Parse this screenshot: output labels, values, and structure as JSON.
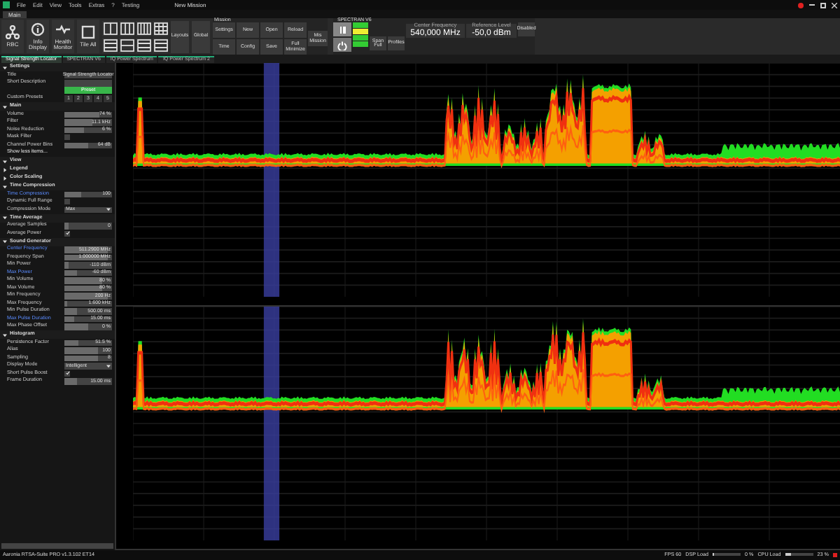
{
  "window": {
    "title": "New Mission"
  },
  "menu": [
    "File",
    "Edit",
    "View",
    "Tools",
    "Extras",
    "?",
    "Testing"
  ],
  "ribbon_tab": {
    "label": "Main",
    "selected": true
  },
  "ribbon_tools": [
    {
      "label": "RBC",
      "kind": "nodes"
    },
    {
      "label": "Info Display",
      "kind": "info"
    },
    {
      "label": "Health Monitor",
      "kind": "pulse"
    },
    {
      "label": "Tile All",
      "kind": "square"
    }
  ],
  "layouts_label": "Layouts",
  "global_label": "Global",
  "mission": {
    "title": "Mission",
    "buttons": [
      "Settings",
      "New",
      "Open",
      "Reload",
      "Time",
      "Config",
      "Save",
      "Full Minimize"
    ],
    "big_button": "Mis Mission"
  },
  "spectran": {
    "title": "SPECTRAN V6",
    "span": "Span Full",
    "profiles": "Profiles",
    "center_label": "Center Frequency",
    "center": "540,000 MHz",
    "ref_label": "Reference Level",
    "ref": "-50,0 dBm",
    "mode": "Disabled"
  },
  "doc_tabs": [
    {
      "label": "Signal Strength Locator",
      "selected": true
    },
    {
      "label": "SPECTRAN V6",
      "selected": false
    },
    {
      "label": "IQ Power Spectrum",
      "selected": false
    },
    {
      "label": "IQ Power Spectrum 2",
      "selected": false
    }
  ],
  "properties": [
    {
      "kind": "header",
      "label": "Settings",
      "expanded": true
    },
    {
      "kind": "text",
      "label": "Title",
      "value": "Signal Strength Locator"
    },
    {
      "kind": "text",
      "label": "Short Description"
    },
    {
      "kind": "button",
      "label": "Preset"
    },
    {
      "kind": "presets",
      "label": "Custom Presets",
      "values": [
        "1",
        "2",
        "3",
        "4",
        "5"
      ]
    },
    {
      "kind": "header",
      "label": "Main",
      "expanded": true
    },
    {
      "kind": "slider",
      "label": "Volume",
      "value": "74 %",
      "level": 0.74
    },
    {
      "kind": "slider",
      "label": "Filter",
      "value": "11.1 kHz",
      "level": 0.6
    },
    {
      "kind": "slider",
      "label": "Noise Reduction",
      "value": "6 %",
      "level": 0.4
    },
    {
      "kind": "check",
      "label": "Mask Filter",
      "checked": false
    },
    {
      "kind": "slider",
      "label": "Channel Power Bins",
      "value": "64 dB",
      "level": 0.5
    },
    {
      "kind": "link",
      "label": "Show less items..."
    },
    {
      "kind": "header",
      "label": "View",
      "expanded": true
    },
    {
      "kind": "header",
      "label": "Legend",
      "expanded": false
    },
    {
      "kind": "header",
      "label": "Color Scaling",
      "expanded": false
    },
    {
      "kind": "header",
      "label": "Time Compression",
      "expanded": true
    },
    {
      "kind": "slider",
      "label": "Time Compression",
      "value": "100",
      "level": 0.35,
      "highlight": true
    },
    {
      "kind": "check",
      "label": "Dynamic Full Range",
      "checked": false
    },
    {
      "kind": "select",
      "label": "Compression Mode",
      "value": "Max"
    },
    {
      "kind": "header",
      "label": "Time Average",
      "expanded": true
    },
    {
      "kind": "slider",
      "label": "Average Samples",
      "value": "0",
      "level": 0.08
    },
    {
      "kind": "check",
      "label": "Average Power",
      "checked": true
    },
    {
      "kind": "header",
      "label": "Sound Generator",
      "expanded": true
    },
    {
      "kind": "slider",
      "label": "Center Frequency",
      "value": "511.2900 MHz",
      "level": 0.9,
      "highlight": true
    },
    {
      "kind": "slider",
      "label": "Frequency Span",
      "value": "1.000000 MHz",
      "level": 0.9
    },
    {
      "kind": "slider",
      "label": "Min Power",
      "value": "-110 dBm",
      "level": 0.08
    },
    {
      "kind": "slider",
      "label": "Max Power",
      "value": "-60 dBm",
      "level": 0.25,
      "highlight": true
    },
    {
      "kind": "slider",
      "label": "Min Volume",
      "value": "80 %",
      "level": 0.8
    },
    {
      "kind": "slider",
      "label": "Max Volume",
      "value": "80 %",
      "level": 0.8
    },
    {
      "kind": "slider",
      "label": "Min Frequency",
      "value": "200 Hz",
      "level": 0.9
    },
    {
      "kind": "slider",
      "label": "Max Frequency",
      "value": "1.600 kHz",
      "level": 0.05
    },
    {
      "kind": "slider",
      "label": "Min Pulse Duration",
      "value": "500.00 ms",
      "level": 0.25
    },
    {
      "kind": "slider",
      "label": "Max Pulse Duration",
      "value": "15.00 ms",
      "level": 0.2,
      "highlight": true
    },
    {
      "kind": "slider",
      "label": "Max Phase Offset",
      "value": "0 %",
      "level": 0.5
    },
    {
      "kind": "header",
      "label": "Histogram",
      "expanded": true
    },
    {
      "kind": "slider",
      "label": "Persistence Factor",
      "value": "51.5 %",
      "level": 0.3
    },
    {
      "kind": "slider",
      "label": "Alias",
      "value": "100",
      "level": 0.7
    },
    {
      "kind": "slider",
      "label": "Sampling",
      "value": "8",
      "level": 0.7
    },
    {
      "kind": "select",
      "label": "Display Mode",
      "value": "Intelligent"
    },
    {
      "kind": "check",
      "label": "Short Pulse Boost",
      "checked": true
    },
    {
      "kind": "slider",
      "label": "Frame Duration",
      "value": "15.00 ms",
      "level": 0.25
    }
  ],
  "status": {
    "version": "Aaronia RTSA-Suite PRO v1.3.102 ET14",
    "fps": "FPS 60",
    "dsp_label": "DSP Load",
    "dsp_value": "0 %",
    "dsp_meter": {
      "level": 0.02
    },
    "cpu_label": "CPU Load",
    "cpu_value": "23 %",
    "cpu_meter": {
      "level": 0.23
    }
  }
}
